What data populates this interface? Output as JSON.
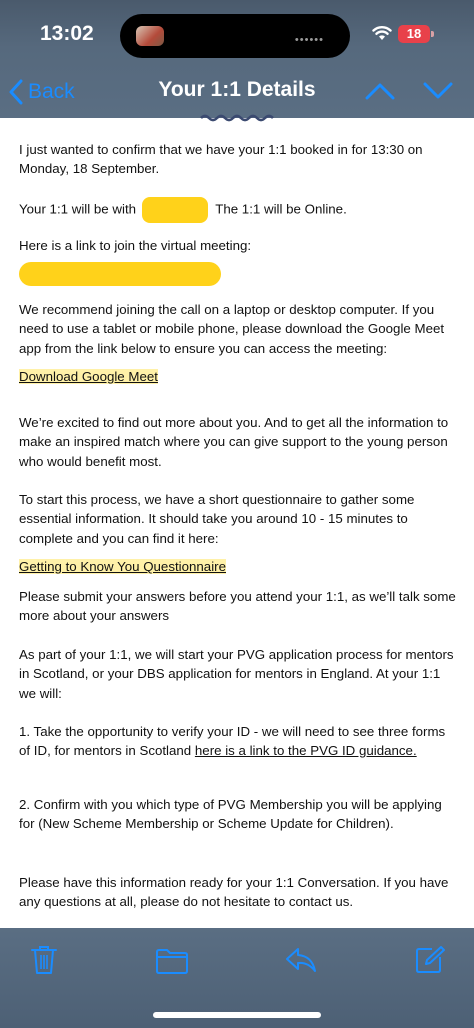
{
  "status": {
    "time": "13:02",
    "battery": "18"
  },
  "nav": {
    "back_label": "Back",
    "title": "Your 1:1 Details"
  },
  "email": {
    "p1": "I just wanted to confirm that we have your 1:1 booked in for 13:30 on Monday, 18 September.",
    "p2_before": "Your 1:1 will be with",
    "p2_after": "The 1:1 will be Online.",
    "p3": "Here is a link to join the virtual meeting:",
    "p4": "We recommend joining the call on a laptop or desktop computer. If you need to use a tablet or mobile phone, please download the Google Meet app from the link below to ensure you can access the meeting:",
    "link_meet": "Download Google Meet",
    "p5": "We’re excited to find out more about you. And to get all the information to make an inspired match where you can give support to the young person who would benefit most.",
    "p6": "To start this process, we have a short questionnaire to gather some essential information. It should take you around 10 - 15 minutes to complete and you can find it here:",
    "link_questionnaire": "Getting to Know You Questionnaire",
    "p7": "Please submit your answers before you attend your 1:1, as we’ll talk some more about your answers",
    "p8": "As part of your 1:1, we will start your PVG application process for mentors in Scotland, or your DBS application for mentors in England. At your 1:1 we will:",
    "p9_before": "1. Take the opportunity to verify your ID - we will need to see three forms of ID, for mentors in Scotland ",
    "link_pvg": "here is a link to the PVG ID guidance.",
    "p10": "2. Confirm with you which type of PVG Membership you will be applying for (New Scheme Membership or Scheme Update for Children).",
    "p11": "Please have this information ready for your 1:1 Conversation. If you have any questions at all, please do not hesitate to contact us."
  },
  "colors": {
    "accent": "#1a8cff",
    "redaction": "#ffd21a",
    "link_highlight": "#fff1a8",
    "battery": "#e8414a"
  },
  "toolbar": {
    "icons": [
      "trash-icon",
      "folder-icon",
      "reply-icon",
      "compose-icon"
    ]
  }
}
